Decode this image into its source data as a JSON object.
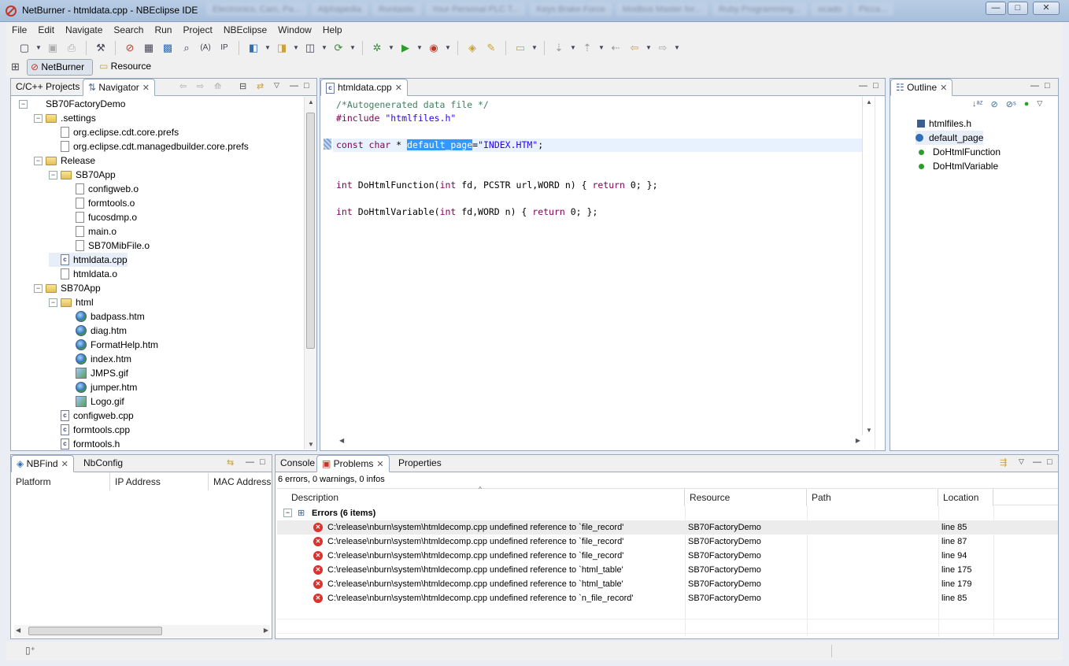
{
  "window": {
    "title": "NetBurner - htmldata.cpp - NBEclipse IDE",
    "blurred_tabs": [
      "Electronics, Carc, Pa...",
      "Alphapedia",
      "Runtastic",
      "Your Personal PLC T...",
      "Keys Brake Force",
      "Modbus Master for...",
      "Ruby Programming...",
      "ocado",
      "Picca..."
    ],
    "minimize": "—",
    "maximize": "□",
    "close": "✕"
  },
  "menu": [
    "File",
    "Edit",
    "Navigate",
    "Search",
    "Run",
    "Project",
    "NBEclipse",
    "Window",
    "Help"
  ],
  "perspectives": {
    "netburner": "NetBurner",
    "resource": "Resource"
  },
  "navigator": {
    "tabs": [
      "C/C++ Projects",
      "Navigator"
    ],
    "tree": [
      {
        "label": "SB70FactoryDemo",
        "depth": 0,
        "icon": "project",
        "toggle": "−"
      },
      {
        "label": ".settings",
        "depth": 1,
        "icon": "folder",
        "toggle": "−"
      },
      {
        "label": "org.eclipse.cdt.core.prefs",
        "depth": 2,
        "icon": "file"
      },
      {
        "label": "org.eclipse.cdt.managedbuilder.core.prefs",
        "depth": 2,
        "icon": "file"
      },
      {
        "label": "Release",
        "depth": 1,
        "icon": "folder",
        "toggle": "−"
      },
      {
        "label": "SB70App",
        "depth": 2,
        "icon": "folder",
        "toggle": "−"
      },
      {
        "label": "configweb.o",
        "depth": 3,
        "icon": "file"
      },
      {
        "label": "formtools.o",
        "depth": 3,
        "icon": "file"
      },
      {
        "label": "fucosdmp.o",
        "depth": 3,
        "icon": "file"
      },
      {
        "label": "main.o",
        "depth": 3,
        "icon": "file"
      },
      {
        "label": "SB70MibFile.o",
        "depth": 3,
        "icon": "file"
      },
      {
        "label": "htmldata.cpp",
        "depth": 2,
        "icon": "cfile",
        "selected": true
      },
      {
        "label": "htmldata.o",
        "depth": 2,
        "icon": "file"
      },
      {
        "label": "SB70App",
        "depth": 1,
        "icon": "folder",
        "toggle": "−"
      },
      {
        "label": "html",
        "depth": 2,
        "icon": "folder",
        "toggle": "−"
      },
      {
        "label": "badpass.htm",
        "depth": 3,
        "icon": "globe"
      },
      {
        "label": "diag.htm",
        "depth": 3,
        "icon": "globe"
      },
      {
        "label": "FormatHelp.htm",
        "depth": 3,
        "icon": "globe"
      },
      {
        "label": "index.htm",
        "depth": 3,
        "icon": "globe"
      },
      {
        "label": "JMPS.gif",
        "depth": 3,
        "icon": "gif"
      },
      {
        "label": "jumper.htm",
        "depth": 3,
        "icon": "globe"
      },
      {
        "label": "Logo.gif",
        "depth": 3,
        "icon": "gif"
      },
      {
        "label": "configweb.cpp",
        "depth": 2,
        "icon": "cfile"
      },
      {
        "label": "formtools.cpp",
        "depth": 2,
        "icon": "cfile"
      },
      {
        "label": "formtools.h",
        "depth": 2,
        "icon": "cfile"
      }
    ]
  },
  "editor": {
    "tab": "htmldata.cpp",
    "lines": {
      "l1": "/*Autogenerated data file */",
      "l2_pp": "#include ",
      "l2_str": "\"htmlfiles.h\"",
      "l3_kw": "const char",
      "l3_a": " * ",
      "l3_sel": "default_page",
      "l3_b": "=",
      "l3_str": "\"INDEX.HTM\"",
      "l3_c": ";",
      "l4_kw1": "int",
      "l4_a": " DoHtmlFunction(",
      "l4_kw2": "int",
      "l4_b": " fd, PCSTR url,WORD n) { ",
      "l4_kw3": "return",
      "l4_c": " 0; };",
      "l5_kw1": "int",
      "l5_a": " DoHtmlVariable(",
      "l5_kw2": "int",
      "l5_b": " fd,WORD n) { ",
      "l5_kw3": "return",
      "l5_c": " 0; };"
    }
  },
  "outline": {
    "tab": "Outline",
    "items": [
      "htmlfiles.h",
      "default_page",
      "DoHtmlFunction",
      "DoHtmlVariable"
    ]
  },
  "nbfind": {
    "tabs": [
      "NBFind",
      "NbConfig"
    ],
    "columns": [
      "Platform",
      "IP Address",
      "MAC Address"
    ]
  },
  "problems": {
    "tabs": [
      "Console",
      "Problems",
      "Properties"
    ],
    "summary": "6 errors, 0 warnings, 0 infos",
    "columns": [
      "Description",
      "Resource",
      "Path",
      "Location"
    ],
    "group": "Errors (6 items)",
    "rows": [
      {
        "description": "C:\\release\\nburn\\system\\htmldecomp.cpp undefined reference to `file_record'",
        "resource": "SB70FactoryDemo",
        "path": "",
        "location": "line 85"
      },
      {
        "description": "C:\\release\\nburn\\system\\htmldecomp.cpp undefined reference to `file_record'",
        "resource": "SB70FactoryDemo",
        "path": "",
        "location": "line 87"
      },
      {
        "description": "C:\\release\\nburn\\system\\htmldecomp.cpp undefined reference to `file_record'",
        "resource": "SB70FactoryDemo",
        "path": "",
        "location": "line 94"
      },
      {
        "description": "C:\\release\\nburn\\system\\htmldecomp.cpp undefined reference to `html_table'",
        "resource": "SB70FactoryDemo",
        "path": "",
        "location": "line 175"
      },
      {
        "description": "C:\\release\\nburn\\system\\htmldecomp.cpp undefined reference to `html_table'",
        "resource": "SB70FactoryDemo",
        "path": "",
        "location": "line 179"
      },
      {
        "description": "C:\\release\\nburn\\system\\htmldecomp.cpp undefined reference to `n_file_record'",
        "resource": "SB70FactoryDemo",
        "path": "",
        "location": "line 85"
      }
    ]
  }
}
